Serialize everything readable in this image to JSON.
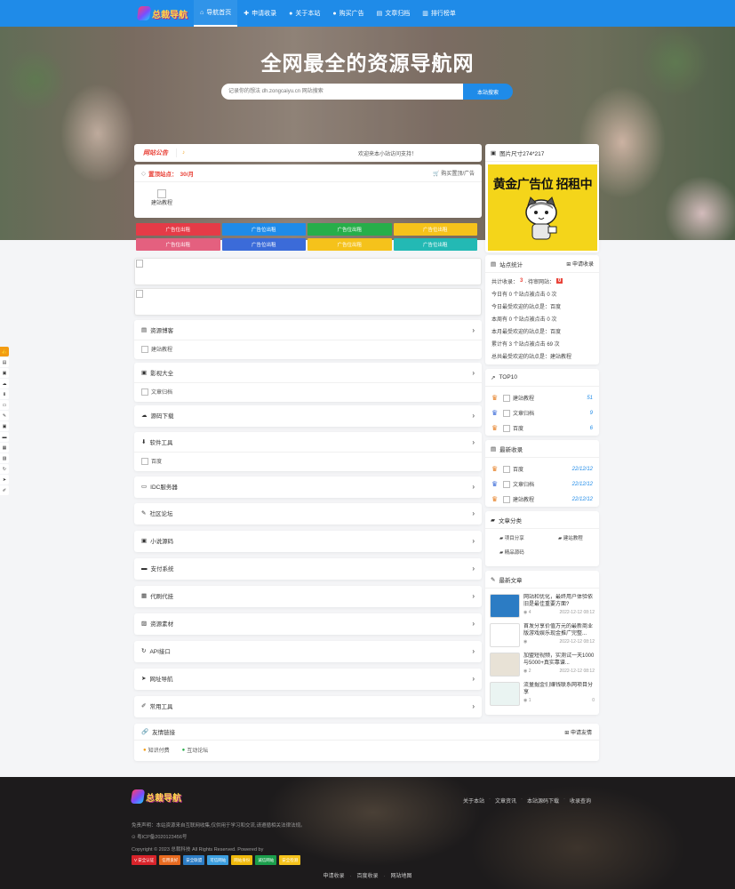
{
  "header": {
    "logo_text": "总裁导航",
    "nav": [
      {
        "icon": "home-icon",
        "glyph": "⌂",
        "label": "导航首页"
      },
      {
        "icon": "plus-icon",
        "glyph": "✚",
        "label": "申请收录"
      },
      {
        "icon": "info-icon",
        "glyph": "●",
        "label": "关于本站"
      },
      {
        "icon": "lock-icon",
        "glyph": "●",
        "label": "购买广告"
      },
      {
        "icon": "calendar-icon",
        "glyph": "▤",
        "label": "文章归档"
      },
      {
        "icon": "chart-icon",
        "glyph": "▥",
        "label": "排行榜单"
      }
    ]
  },
  "hero": {
    "title": "全网最全的资源导航网",
    "search_placeholder": "记录你的想法 dh.zongcaiyu.cn 网站搜索",
    "search_button": "本站搜索"
  },
  "notice": {
    "tag": "网站公告",
    "text": "欢迎来本小站访问支持！"
  },
  "featured": {
    "title": "置顶站点：",
    "price": "30/月",
    "buy": "购买置顶/广告",
    "item": "建站教程"
  },
  "ads": [
    {
      "label": "广告位出租",
      "color": "#e53b47"
    },
    {
      "label": "广告位出租",
      "color": "#1f8be8"
    },
    {
      "label": "广告位出租",
      "color": "#27ae4a"
    },
    {
      "label": "广告位出租",
      "color": "#f5c21b"
    },
    {
      "label": "广告位出租",
      "color": "#e4607f"
    },
    {
      "label": "广告位出租",
      "color": "#3b6bd9"
    },
    {
      "label": "广告位出租",
      "color": "#f5c21b"
    },
    {
      "label": "广告位出租",
      "color": "#23b9b4"
    }
  ],
  "categories": [
    {
      "icon": "book-icon",
      "glyph": "▤",
      "label": "资源博客",
      "items": [
        "建站教程"
      ]
    },
    {
      "icon": "film-icon",
      "glyph": "▣",
      "label": "影视大全",
      "items": [
        "文章归档"
      ]
    },
    {
      "icon": "cloud-download-icon",
      "glyph": "☁",
      "label": "源码下载",
      "items": []
    },
    {
      "icon": "download-icon",
      "glyph": "⬇",
      "label": "软件工具",
      "items": [
        "百度"
      ]
    },
    {
      "icon": "monitor-icon",
      "glyph": "▭",
      "label": "IDC服务器",
      "items": []
    },
    {
      "icon": "edit-icon",
      "glyph": "✎",
      "label": "社区论坛",
      "items": []
    },
    {
      "icon": "game-icon",
      "glyph": "▣",
      "label": "小说源码",
      "items": []
    },
    {
      "icon": "keyboard-icon",
      "glyph": "▬",
      "label": "支付系统",
      "items": []
    },
    {
      "icon": "briefcase-icon",
      "glyph": "▦",
      "label": "代刷代挂",
      "items": []
    },
    {
      "icon": "image-icon",
      "glyph": "▨",
      "label": "资源素材",
      "items": []
    },
    {
      "icon": "refresh-icon",
      "glyph": "↻",
      "label": "API接口",
      "items": []
    },
    {
      "icon": "send-icon",
      "glyph": "➤",
      "label": "网址导航",
      "items": []
    },
    {
      "icon": "tool-icon",
      "glyph": "✐",
      "label": "常用工具",
      "items": []
    }
  ],
  "sidebar": {
    "ad": {
      "title": "图片尺寸274*217",
      "gold_text": "黄金广告位 招租中"
    },
    "stats": {
      "title": "站点统计",
      "apply": "申请收录",
      "total_label": "共计收录：",
      "total": "3",
      "pending_label": "· 待审网站：",
      "pending": "0",
      "lines": [
        "今日有 0 个站点被点击 0 次",
        "今日最受欢迎的站点是：百度",
        "本周有 0 个站点被点击 0 次",
        "本月最受欢迎的站点是：百度",
        "累计有 3 个站点被点击 69 次",
        "总共最受欢迎的站点是：建站教程"
      ]
    },
    "top10": {
      "title": "TOP10",
      "items": [
        {
          "name": "建站教程",
          "num": "51",
          "crown": "#e67e22"
        },
        {
          "name": "文章归档",
          "num": "9",
          "crown": "#3b6bd9"
        },
        {
          "name": "百度",
          "num": "6",
          "crown": "#e67e22"
        }
      ]
    },
    "latest": {
      "title": "最新收录",
      "items": [
        {
          "name": "百度",
          "date": "22/12/12",
          "crown": "#e67e22"
        },
        {
          "name": "文章归档",
          "date": "22/12/12",
          "crown": "#3b6bd9"
        },
        {
          "name": "建站教程",
          "date": "22/12/12",
          "crown": "#e67e22"
        }
      ]
    },
    "article_cat": {
      "title": "文章分类",
      "items": [
        "项目分享",
        "建站教程",
        "精品源码"
      ]
    },
    "articles": {
      "title": "最新文章",
      "items": [
        {
          "title": "网站和优化，最终用户体验依旧是最佳重要方面?",
          "views": "4",
          "date": "2022-12-12 08:12",
          "thumb": "#2c7cc4"
        },
        {
          "title": "首发分享价值万元的最新商业版游戏娱乐现金推广完整...",
          "views": "",
          "date": "2022-12-12 08:12",
          "thumb": "#ffffff"
        },
        {
          "title": "加盟短视频，实测试一天1000与5000+真实靠谱...",
          "views": "2",
          "date": "2022-12-12 08:12",
          "thumb": "#e8e2d6"
        },
        {
          "title": "流量掘金们赚钱联系网项目分享",
          "views": "1",
          "date": "0",
          "thumb": "#eaf4f2"
        }
      ]
    }
  },
  "links": {
    "title": "友情链接",
    "apply": "申请友情",
    "items": [
      "知识付费",
      "互动论坛"
    ]
  },
  "footer": {
    "logo_text": "总裁导航",
    "links": [
      "关于本站",
      "文章资讯",
      "本站源码下载",
      "收录查询"
    ],
    "disclaimer": "免责声明：本站资源来自互联网收集,仅供用于学习和交流,请遵循相关法律法规。",
    "icp": "粤ICP备2020123456号",
    "copyright": "Copyright © 2023 总裁科技 All Rights Reserved. Powered by",
    "badges": [
      {
        "label": "V 安全认证",
        "color": "#d8232a"
      },
      {
        "label": "信用良好",
        "color": "#e86a1f"
      },
      {
        "label": "安全联盟",
        "color": "#2c7cc4"
      },
      {
        "label": "可信网站",
        "color": "#3c9fe0"
      },
      {
        "label": "网站身份",
        "color": "#f0b90b"
      },
      {
        "label": "诚信网站",
        "color": "#1b9e4b"
      },
      {
        "label": "安全检测",
        "color": "#f5c21b"
      }
    ],
    "bottom": [
      "申请收录",
      "百度收录",
      "网站地图"
    ]
  },
  "float_bar": [
    "thumbs-up-icon",
    "book-icon",
    "film-icon",
    "cloud-icon",
    "download-icon",
    "monitor-icon",
    "edit-icon",
    "game-icon",
    "keyboard-icon",
    "briefcase-icon",
    "image-icon",
    "refresh-icon",
    "send-icon",
    "tool-icon"
  ]
}
